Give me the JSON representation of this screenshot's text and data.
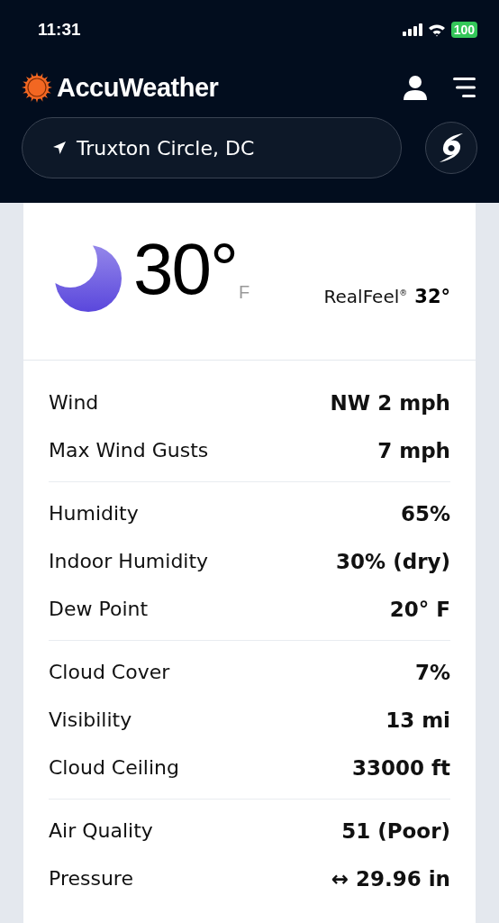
{
  "status_bar": {
    "time": "11:31",
    "battery": "100"
  },
  "header": {
    "brand": "AccuWeather",
    "location": "Truxton Circle, DC"
  },
  "current": {
    "temperature": "30°",
    "unit": "F",
    "realfeel_label": "RealFeel$^{®}$",
    "realfeel_value": "32°"
  },
  "details": [
    [
      {
        "label": "Wind",
        "value": "NW 2 mph"
      },
      {
        "label": "Max Wind Gusts",
        "value": "7 mph"
      }
    ],
    [
      {
        "label": "Humidity",
        "value": "65%"
      },
      {
        "label": "Indoor Humidity",
        "value": "30% (dry)"
      },
      {
        "label": "Dew Point",
        "value": "20° F"
      }
    ],
    [
      {
        "label": "Cloud Cover",
        "value": "7%"
      },
      {
        "label": "Visibility",
        "value": "13 mi"
      },
      {
        "label": "Cloud Ceiling",
        "value": "33000 ft"
      }
    ],
    [
      {
        "label": "Air Quality",
        "value": "51 (Poor)"
      },
      {
        "label": "Pressure",
        "value": "↔ 29.96 in"
      }
    ]
  ]
}
